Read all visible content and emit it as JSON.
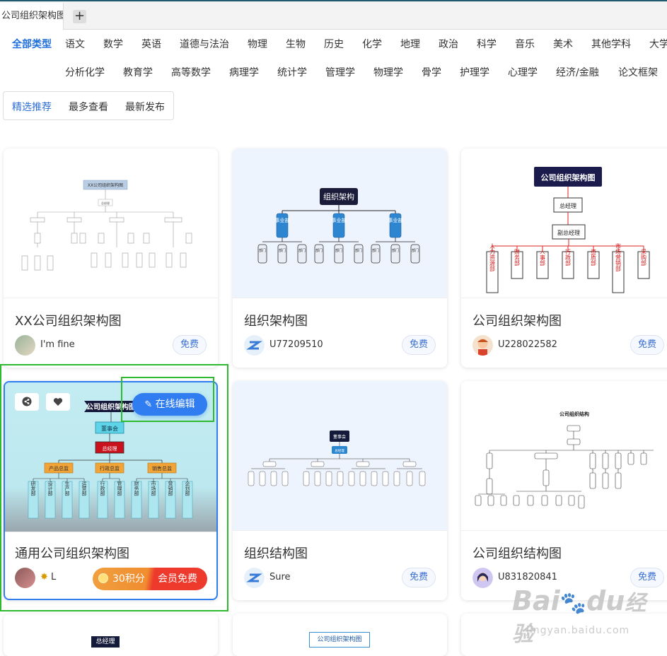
{
  "browser": {
    "tab_title": "公司组织架构图",
    "close_glyph": "×",
    "new_tab_glyph": "+"
  },
  "categories_row1": [
    "全部类型",
    "语文",
    "数学",
    "英语",
    "道德与法治",
    "物理",
    "生物",
    "历史",
    "化学",
    "地理",
    "政治",
    "科学",
    "音乐",
    "美术",
    "其他学科",
    "大学"
  ],
  "categories_row2": [
    "分析化学",
    "教育学",
    "高等数学",
    "病理学",
    "统计学",
    "管理学",
    "物理学",
    "骨学",
    "护理学",
    "心理学",
    "经济/金融",
    "论文框架"
  ],
  "sort_tabs": [
    "精选推荐",
    "最多查看",
    "最新发布"
  ],
  "cards": [
    {
      "title": "XX公司组织架构图",
      "author": "I'm fine",
      "badge": "免费",
      "thumb_label": "XX公司组织架构图",
      "thumb_sub": "总经理"
    },
    {
      "title": "组织架构图",
      "author": "U77209510",
      "badge": "免费",
      "thumb_label": "组织架构",
      "thumb_dept": "事业部",
      "thumb_leaf": "部门"
    },
    {
      "title": "公司组织架构图",
      "author": "U228022582",
      "badge": "免费",
      "thumb_label": "公司组织架构图",
      "thumb_gm": "总经理",
      "thumb_vgm": "副总经理",
      "thumb_depts": [
        "人力资源部",
        "财务部",
        "人事部",
        "行政部",
        "资质部",
        "市场营销部",
        "采购部"
      ]
    },
    {
      "title": "通用公司组织架构图",
      "author": "L",
      "points": "30积分",
      "vip": "会员免费",
      "edit_button": "在线编辑",
      "thumb_label": "公司组织架构图",
      "thumb_board": "董事会",
      "thumb_gm": "总经理",
      "thumb_mid": [
        "产品总监",
        "行政总监",
        "销售总监"
      ],
      "thumb_leaves": [
        "研发部",
        "设计部",
        "生产部",
        "运营部",
        "行政部",
        "管理部",
        "财务部",
        "市场部",
        "营销部",
        "企划部"
      ]
    },
    {
      "title": "组织结构图",
      "author": "Sure",
      "badge": "免费",
      "thumb_label": "董事会",
      "thumb_sub": "总经理"
    },
    {
      "title": "公司组织结构图",
      "author": "U831820841",
      "badge": "免费",
      "thumb_label": "公司组织结构"
    },
    {
      "thumb_label": "总经理"
    },
    {
      "thumb_label": "公司组织架构图"
    }
  ],
  "watermark": {
    "main": "Bai",
    "paw": "🐾",
    "tail": "du",
    "cn": "经验",
    "url": "jingyan.baidu.com"
  },
  "colors": {
    "accent": "#2d6fd4",
    "green_highlight": "#2fb92f",
    "edit_button": "#2f7df0",
    "points_orange": "#f09433",
    "vip_red": "#ee3a2c"
  }
}
